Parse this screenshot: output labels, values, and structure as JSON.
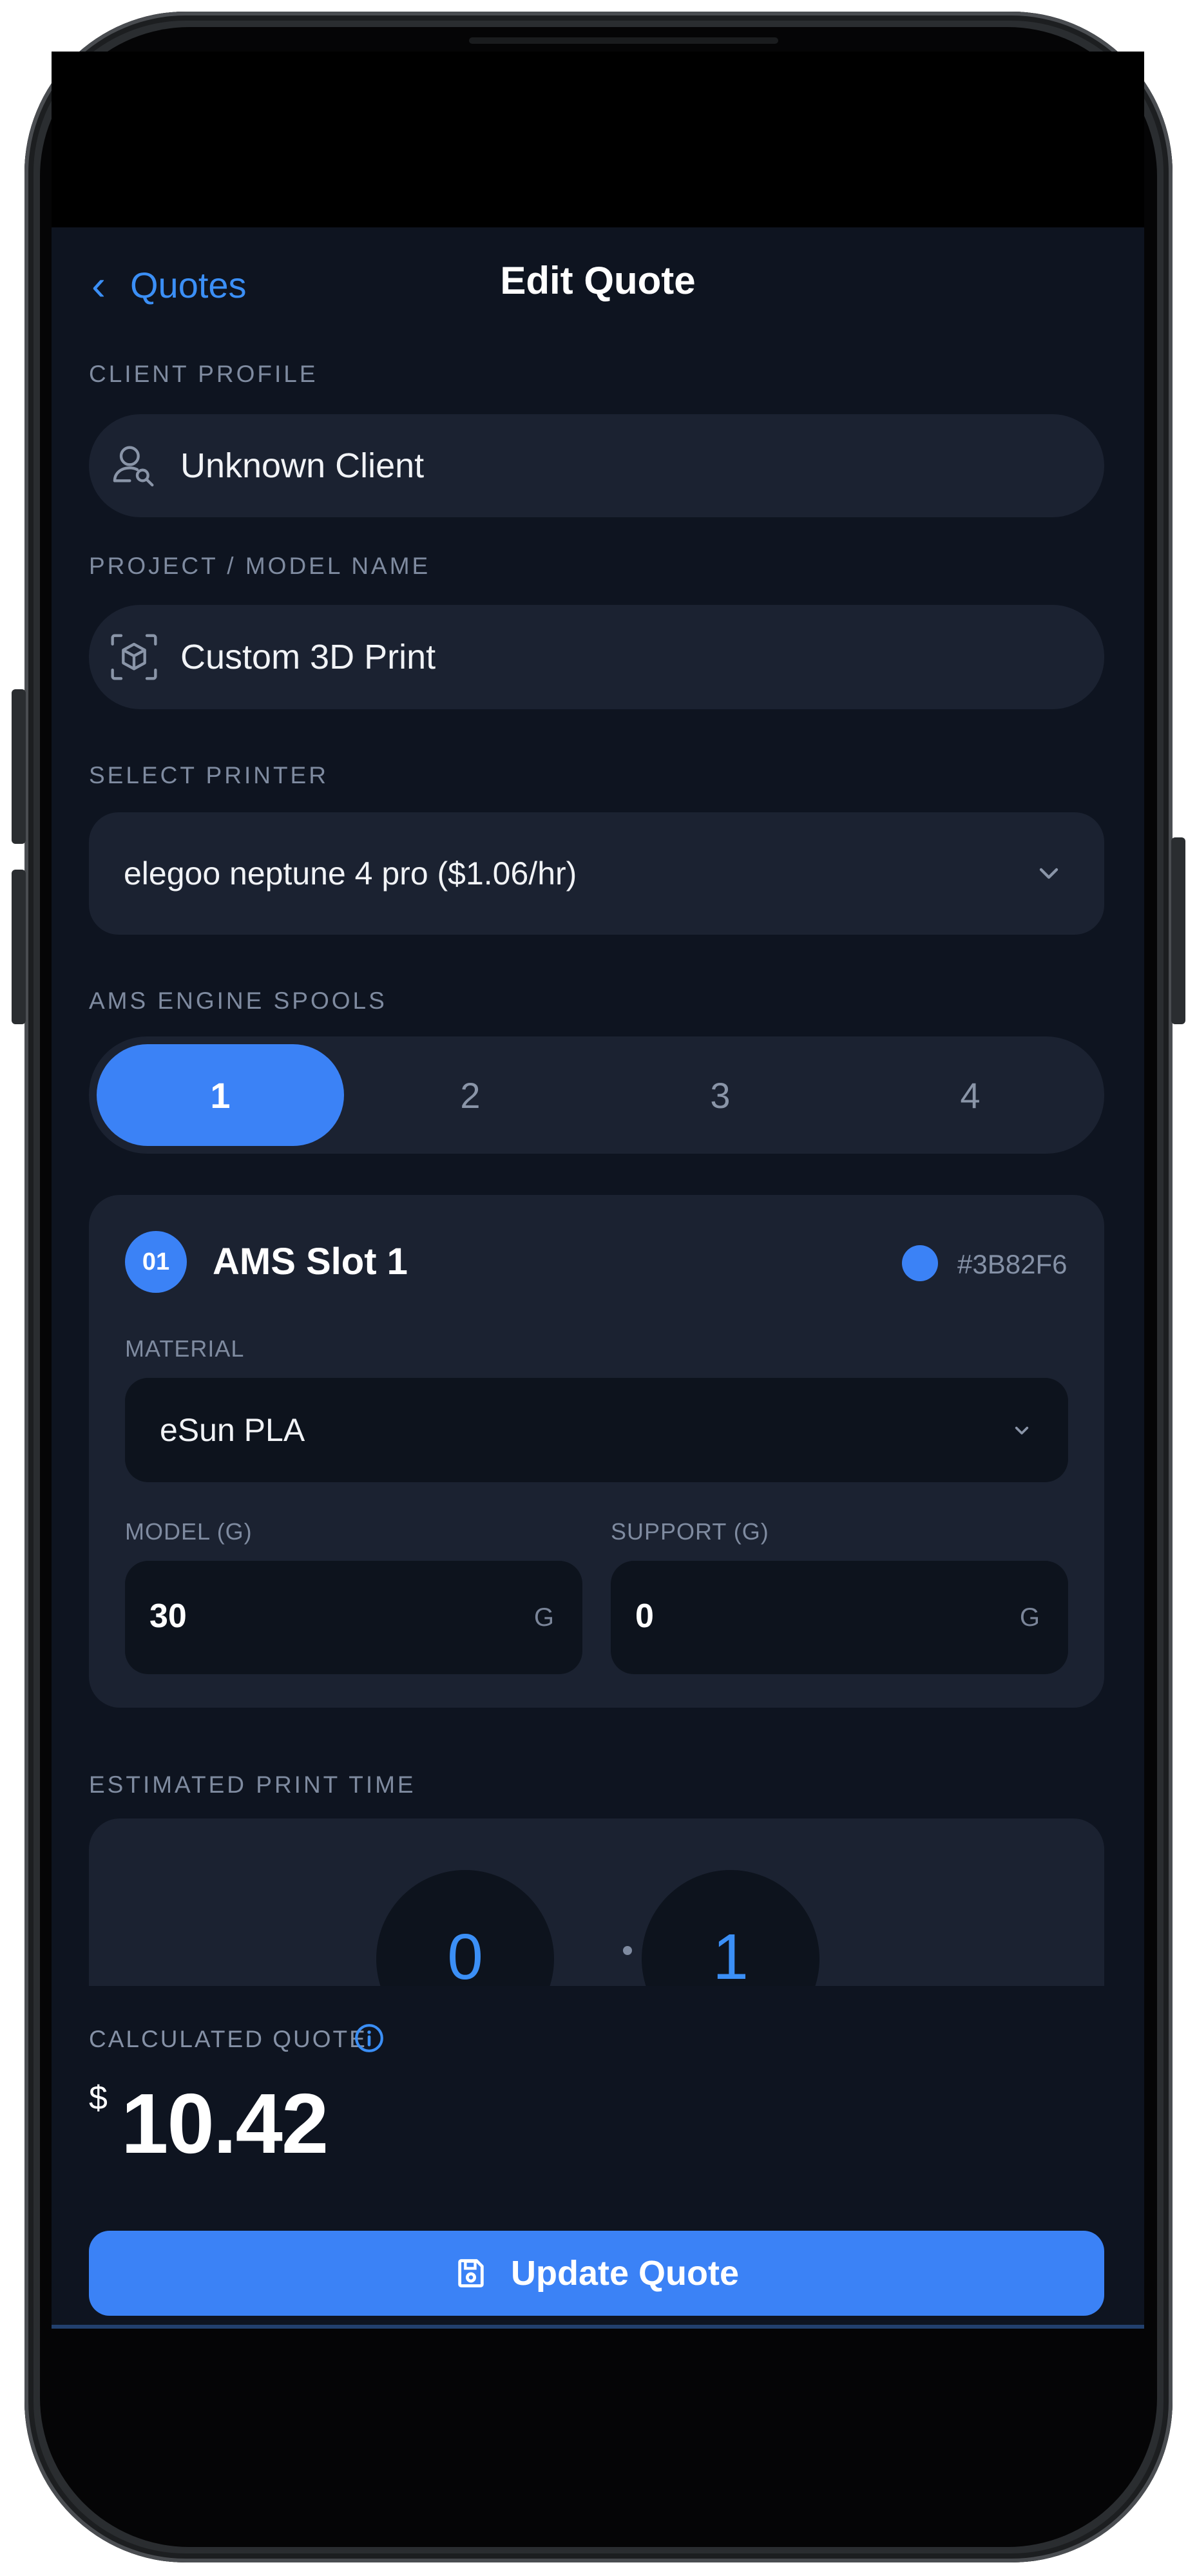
{
  "header": {
    "back_label": "Quotes",
    "title": "Edit Quote"
  },
  "client": {
    "label": "CLIENT PROFILE",
    "value": "Unknown Client",
    "icon": "user-search-icon"
  },
  "project": {
    "label": "PROJECT / MODEL NAME",
    "value": "Custom 3D Print",
    "icon": "cube-scan-icon"
  },
  "printer": {
    "label": "SELECT PRINTER",
    "value": "elegoo neptune 4 pro ($1.06/hr)"
  },
  "spools": {
    "label": "AMS ENGINE SPOOLS",
    "items": [
      "1",
      "2",
      "3",
      "4"
    ],
    "active": "1"
  },
  "slot": {
    "badge": "01",
    "title": "AMS Slot 1",
    "color_hex": "#3B82F6",
    "material_label": "MATERIAL",
    "material_value": "eSun PLA",
    "model_label": "MODEL (G)",
    "model_value": "30",
    "support_label": "SUPPORT (G)",
    "support_value": "0",
    "unit": "G"
  },
  "print_time": {
    "label": "ESTIMATED PRINT TIME",
    "hours": "0",
    "minutes": "1"
  },
  "quote": {
    "label": "CALCULATED QUOTE",
    "currency": "$",
    "amount": "10.42",
    "button_label": "Update Quote"
  },
  "colors": {
    "accent": "#3b82f6",
    "background": "#0e1420",
    "surface": "#1b2231",
    "input": "#0d131d"
  }
}
